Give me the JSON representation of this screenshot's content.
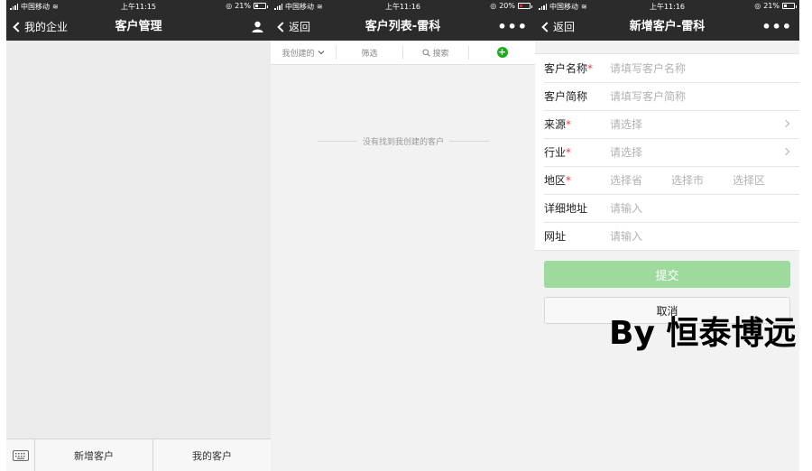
{
  "screen1": {
    "status": {
      "carrier": "中国移动",
      "time": "上午11:15",
      "battery": "21%"
    },
    "nav": {
      "back_label": "我的企业",
      "title": "客户管理"
    },
    "tabbar": {
      "items": [
        "新增客户",
        "我的客户"
      ]
    }
  },
  "screen2": {
    "status": {
      "carrier": "中国移动",
      "time": "上午11:16",
      "battery": "20%"
    },
    "nav": {
      "back_label": "返回",
      "title": "客户列表-雷科",
      "more": "•••"
    },
    "filters": {
      "scope": "我创建的",
      "filter": "筛选",
      "search": "搜索",
      "add": "+"
    },
    "empty_text": "没有找到我创建的客户"
  },
  "screen3": {
    "status": {
      "carrier": "中国移动",
      "time": "上午11:16",
      "battery": "21%"
    },
    "nav": {
      "back_label": "返回",
      "title": "新增客户-雷科",
      "more": "•••"
    },
    "form": {
      "rows": [
        {
          "label": "客户名称",
          "required": "*",
          "placeholder": "请填写客户名称"
        },
        {
          "label": "客户简称",
          "required": "",
          "placeholder": "请填写客户简称"
        },
        {
          "label": "来源",
          "required": "*",
          "placeholder": "请选择"
        },
        {
          "label": "行业",
          "required": "*",
          "placeholder": "请选择"
        },
        {
          "label": "地区",
          "required": "*",
          "province": "选择省",
          "city": "选择市",
          "district": "选择区"
        },
        {
          "label": "详细地址",
          "required": "",
          "placeholder": "请输入"
        },
        {
          "label": "网址",
          "required": "",
          "placeholder": "请输入"
        }
      ]
    },
    "submit_label": "提交",
    "cancel_label": "取消"
  },
  "watermark": "By 恒泰博远",
  "colors": {
    "navbar": "#2b2b2b",
    "accent_green": "#1aad19",
    "submit_disabled": "#9ed99d",
    "required_red": "#e64340"
  }
}
